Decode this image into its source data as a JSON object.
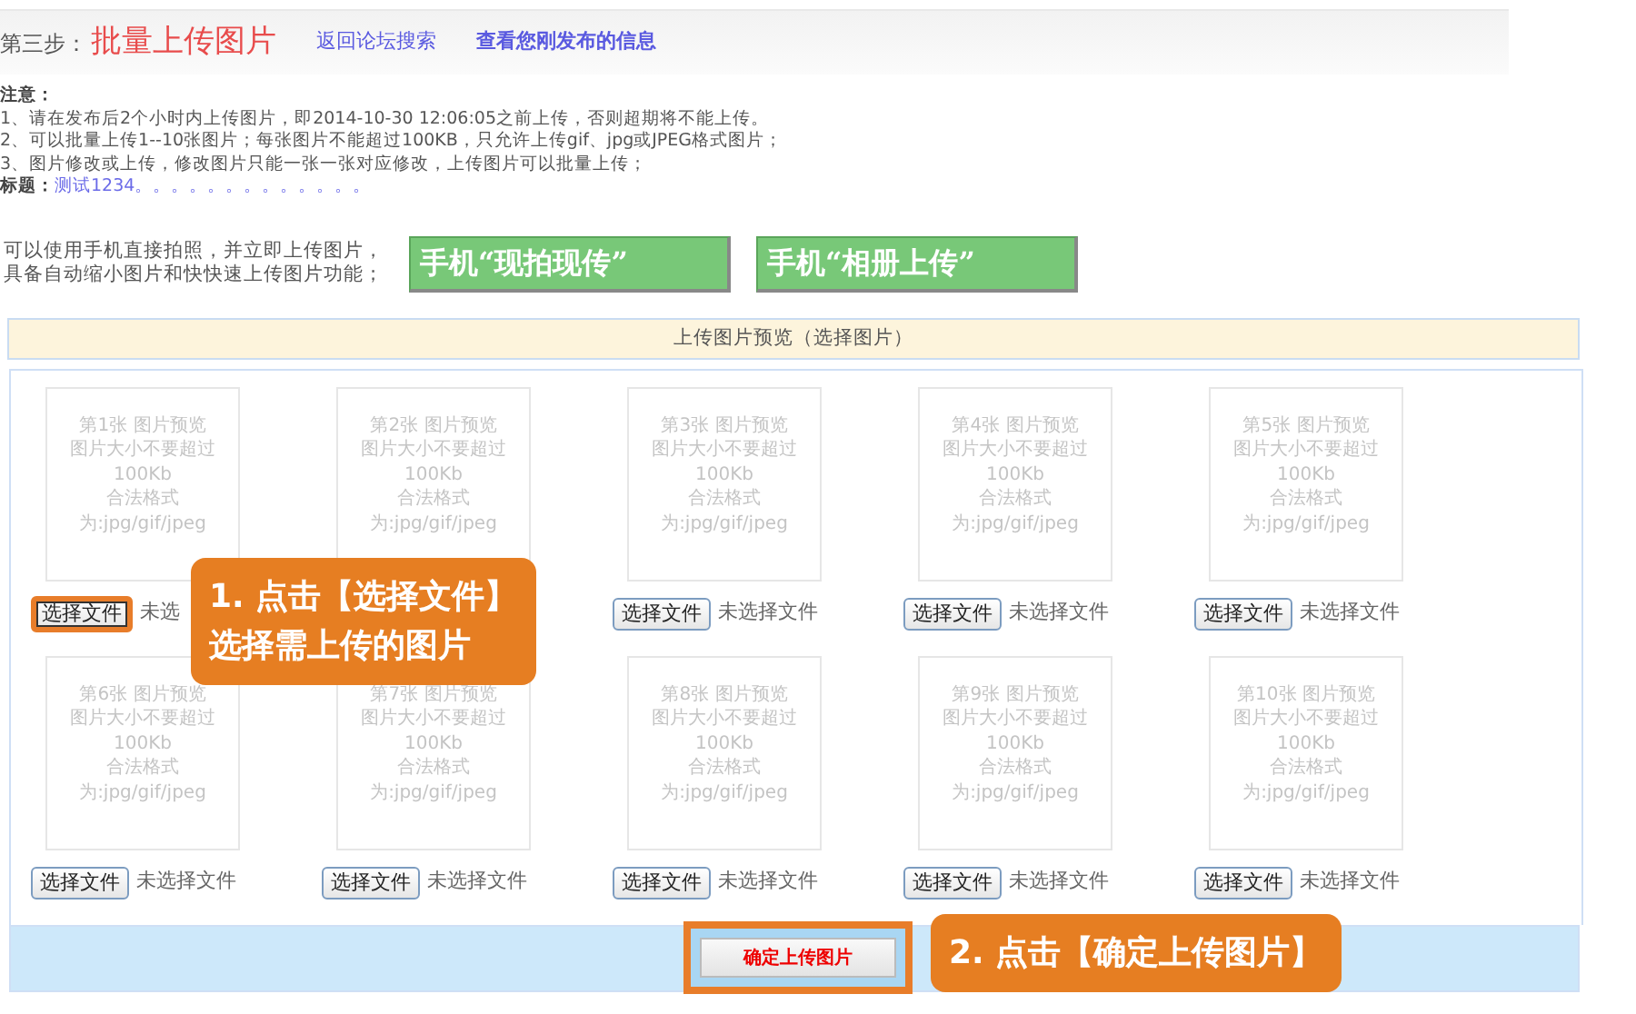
{
  "header": {
    "step_label": "第三步：",
    "step_title": "批量上传图片",
    "links": [
      "返回论坛搜索",
      "查看您刚发布的信息"
    ]
  },
  "notice": {
    "heading": "注意：",
    "lines": [
      "1、请在发布后2个小时内上传图片，即2014-10-30 12:06:05之前上传，否则超期将不能上传。",
      "2、可以批量上传1--10张图片；每张图片不能超过100KB，只允许上传gif、jpg或JPEG格式图片；",
      "3、图片修改或上传，修改图片只能一张一张对应修改，上传图片可以批量上传；"
    ],
    "title_label": "标题：",
    "title_value": "测试1234。。。。。。。。。。。。。"
  },
  "phone": {
    "text": "可以使用手机直接拍照，并立即上传图片，具备自动缩小图片和快快速上传图片功能；",
    "buttons": [
      "手机“现拍现传”",
      "手机“相册上传”"
    ]
  },
  "preview_header": "上传图片预览（选择图片）",
  "slots": [
    {
      "lines": [
        "第1张  图片预览",
        "图片大小不要超过",
        "100Kb",
        "合法格式",
        "为:jpg/gif/jpeg"
      ],
      "button": "选择文件",
      "status": "未选",
      "highlighted": true
    },
    {
      "lines": [
        "第2张  图片预览",
        "图片大小不要超过",
        "100Kb",
        "合法格式",
        "为:jpg/gif/jpeg"
      ]
    },
    {
      "lines": [
        "第3张  图片预览",
        "图片大小不要超过",
        "100Kb",
        "合法格式",
        "为:jpg/gif/jpeg"
      ],
      "button": "选择文件",
      "status": "未选择文件",
      "highlighted": false
    },
    {
      "lines": [
        "第4张  图片预览",
        "图片大小不要超过",
        "100Kb",
        "合法格式",
        "为:jpg/gif/jpeg"
      ],
      "button": "选择文件",
      "status": "未选择文件",
      "highlighted": false
    },
    {
      "lines": [
        "第5张  图片预览",
        "图片大小不要超过",
        "100Kb",
        "合法格式",
        "为:jpg/gif/jpeg"
      ],
      "button": "选择文件",
      "status": "未选择文件",
      "highlighted": false
    },
    {
      "lines": [
        "第6张  图片预览",
        "图片大小不要超过",
        "100Kb",
        "合法格式",
        "为:jpg/gif/jpeg"
      ],
      "button": "选择文件",
      "status": "未选择文件",
      "highlighted": false
    },
    {
      "lines": [
        "第7张  图片预览",
        "图片大小不要超过",
        "100Kb",
        "合法格式",
        "为:jpg/gif/jpeg"
      ],
      "button": "选择文件",
      "status": "未选择文件",
      "highlighted": false
    },
    {
      "lines": [
        "第8张  图片预览",
        "图片大小不要超过",
        "100Kb",
        "合法格式",
        "为:jpg/gif/jpeg"
      ],
      "button": "选择文件",
      "status": "未选择文件",
      "highlighted": false
    },
    {
      "lines": [
        "第9张  图片预览",
        "图片大小不要超过",
        "100Kb",
        "合法格式",
        "为:jpg/gif/jpeg"
      ],
      "button": "选择文件",
      "status": "未选择文件",
      "highlighted": false
    },
    {
      "lines": [
        "第10张  图片预览",
        "图片大小不要超过",
        "100Kb",
        "合法格式",
        "为:jpg/gif/jpeg"
      ],
      "button": "选择文件",
      "status": "未选择文件",
      "highlighted": false
    }
  ],
  "confirm": {
    "label": "确定上传图片",
    "highlighted": true
  },
  "callouts": [
    {
      "lines": [
        "1. 点击【选择文件】",
        "选择需上传的图片"
      ]
    },
    {
      "lines": [
        "2. 点击【确定上传图片】"
      ]
    }
  ]
}
